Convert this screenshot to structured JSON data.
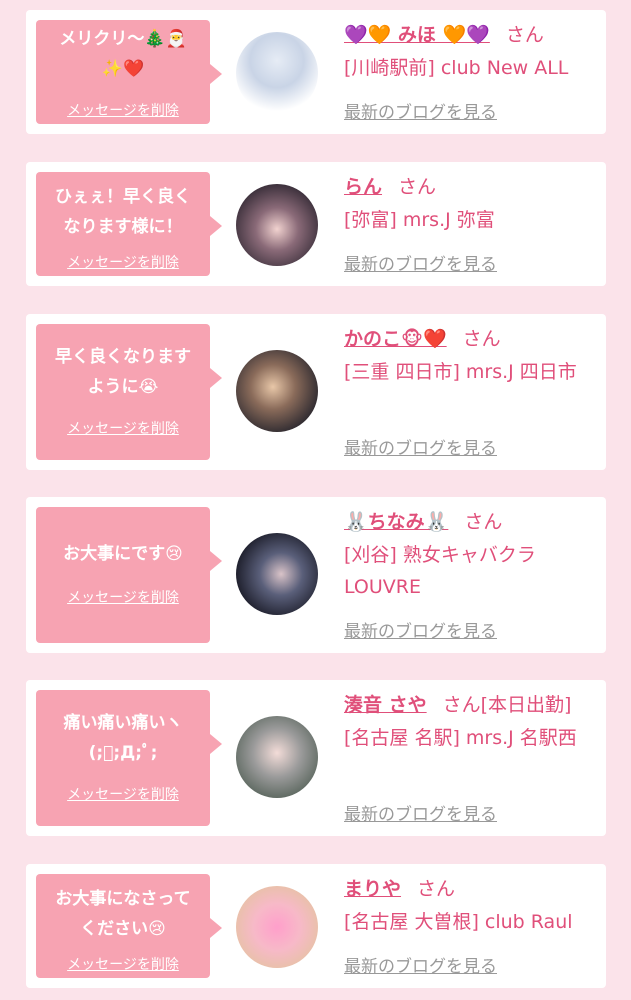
{
  "items": [
    {
      "message": "メリクリ〜🎄🎅\n✨❤️",
      "delete_label": "メッセージを削除",
      "name": "💜🧡 みほ 🧡💜",
      "honorific": "さん",
      "extra": "",
      "shop": "[川崎駅前] club New ALL",
      "blog_link": "最新のブログを見る"
    },
    {
      "message": "ひぇぇ！早く良く\nなります様に！",
      "delete_label": "メッセージを削除",
      "name": "らん",
      "honorific": "さん",
      "extra": "",
      "shop": "[弥富] mrs.J 弥富",
      "blog_link": "最新のブログを見る"
    },
    {
      "message": "早く良くなります\nように😭",
      "delete_label": "メッセージを削除",
      "name": "かのこ🐵❤️",
      "honorific": "さん",
      "extra": "",
      "shop": "[三重 四日市] mrs.J 四日市",
      "blog_link": "最新のブログを見る"
    },
    {
      "message": "お大事にです😢",
      "delete_label": "メッセージを削除",
      "name": "🐰ちなみ🐰",
      "honorific": "さん",
      "extra": "",
      "shop": "[刈谷] 熟女キャバクラ LOUVRE",
      "blog_link": "最新のブログを見る"
    },
    {
      "message": "痛い痛い痛いヽ\n(;ﾟ;Д;ﾟ;",
      "delete_label": "メッセージを削除",
      "name": "湊音 さや",
      "honorific": "さん",
      "extra": "[本日出勤]",
      "shop": "[名古屋 名駅] mrs.J 名駅西",
      "blog_link": "最新のブログを見る"
    },
    {
      "message": "お大事になさって\nください😢",
      "delete_label": "メッセージを削除",
      "name": "まりや",
      "honorific": "さん",
      "extra": "",
      "shop": "[名古屋 大曽根] club Raul",
      "blog_link": "最新のブログを見る"
    }
  ],
  "colors": {
    "page_bg": "#fbe3ea",
    "card_bg": "#ffffff",
    "bubble_bg": "#f7a3b2",
    "accent": "#e04f7a",
    "link_gray": "#999999"
  }
}
